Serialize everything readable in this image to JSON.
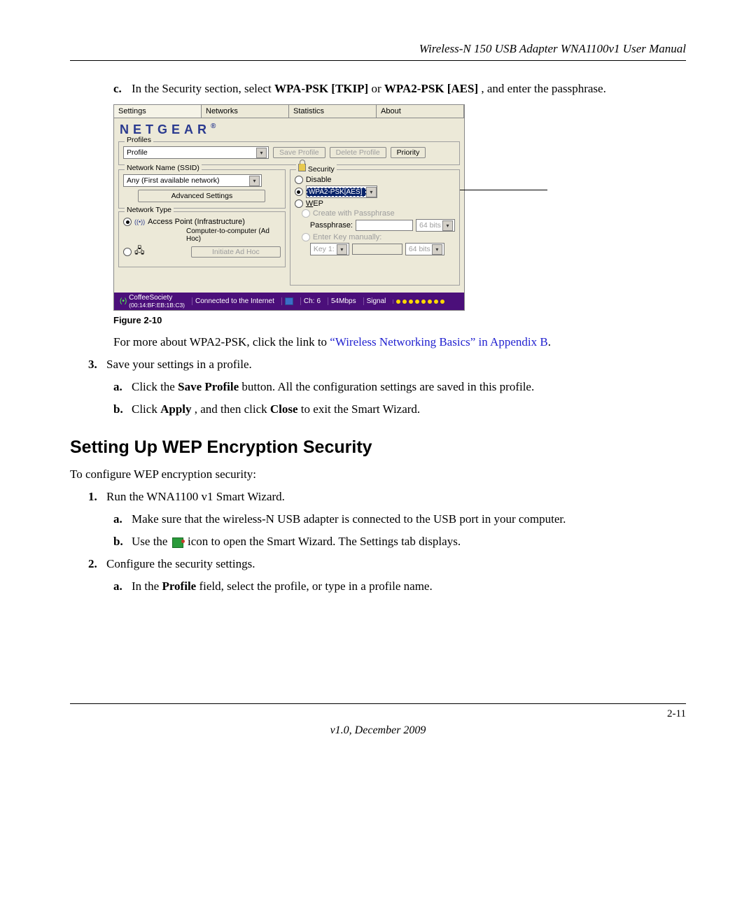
{
  "header": {
    "title": "Wireless-N 150 USB Adapter WNA1100v1 User Manual"
  },
  "footer": {
    "page": "2-11",
    "version": "v1.0, December 2009"
  },
  "step_c": {
    "marker": "c.",
    "text_before": "In the Security section, select ",
    "opt1": "WPA-PSK [TKIP]",
    "or": " or ",
    "opt2": "WPA2-PSK [AES]",
    "text_after": ", and enter the passphrase."
  },
  "figure": {
    "caption": "Figure 2-10",
    "tabs": {
      "settings": "Settings",
      "networks": "Networks",
      "statistics": "Statistics",
      "about": "About"
    },
    "brand": "NETGEAR",
    "profiles": {
      "legend": "Profiles",
      "profile_label": "Profile",
      "save_profile": "Save Profile",
      "delete_profile": "Delete Profile",
      "priority": "Priority"
    },
    "ssid": {
      "legend": "Network Name (SSID)",
      "value": "Any (First available network)",
      "advanced": "Advanced Settings"
    },
    "nettype": {
      "legend": "Network Type",
      "ap": "Access Point (Infrastructure)",
      "adhoc": "Computer-to-computer (Ad Hoc)",
      "initiate": "Initiate Ad Hoc"
    },
    "security": {
      "legend": "Security",
      "disable": "Disable",
      "selected": "WPA2-PSK[AES]",
      "wep": "WEP",
      "create_pass": "Create with Passphrase",
      "passphrase": "Passphrase:",
      "bits1": "64 bits",
      "enter_key": "Enter Key manually:",
      "key1": "Key 1:",
      "bits2": "64 bits"
    },
    "status": {
      "ssid": "CoffeeSociety",
      "mac": "(00:14:BF:EB:1B:C3)",
      "conn": "Connected to the Internet",
      "ch_label": "Ch:",
      "ch": "6",
      "rate": "54Mbps",
      "signal": "Signal"
    }
  },
  "after_fig": {
    "pre": "For more about WPA2-PSK, click the link to ",
    "link": "“Wireless Networking Basics” in Appendix B",
    "post": "."
  },
  "step3": {
    "marker": "3.",
    "text": "Save your settings in a profile.",
    "a": {
      "marker": "a.",
      "pre": "Click the ",
      "bold": "Save Profile",
      "post": " button. All the configuration settings are saved in this profile."
    },
    "b": {
      "marker": "b.",
      "pre": "Click ",
      "bold1": "Apply",
      "mid": ", and then click ",
      "bold2": "Close",
      "post": " to exit the Smart Wizard."
    }
  },
  "section": {
    "heading": "Setting Up WEP Encryption Security",
    "intro": "To configure WEP encryption security:"
  },
  "steps2": {
    "s1": {
      "marker": "1.",
      "text": "Run the WNA1100 v1 Smart Wizard.",
      "a": {
        "marker": "a.",
        "text": "Make sure that the wireless-N USB adapter is connected to the USB port in your computer."
      },
      "b": {
        "marker": "b.",
        "pre": "Use the ",
        "post": " icon to open the Smart Wizard. The Settings tab displays."
      }
    },
    "s2": {
      "marker": "2.",
      "text": "Configure the security settings.",
      "a": {
        "marker": "a.",
        "pre": "In the ",
        "bold": "Profile",
        "post": " field, select the profile, or type in a profile name."
      }
    }
  }
}
